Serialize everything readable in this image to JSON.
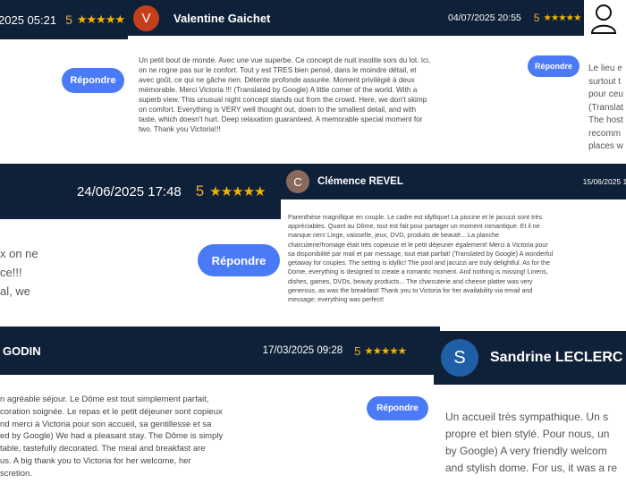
{
  "colors": {
    "header_bg": "#0f2138",
    "button_bg": "#4a7af5",
    "star": "#f5b301",
    "score": "#e8a93b"
  },
  "reply_label": "Répondre",
  "star_glyphs": "★★★★★",
  "reviews": [
    {
      "date_fragment": "2025 05:21",
      "score": "5"
    },
    {
      "name": "Valentine Gaichet",
      "initial": "V",
      "avatar_color": "#c43f1c",
      "text": "Un petit bout de monde. Avec une vue superbe. Ce concept de nuit insolite sors du lot. Ici, on ne rogne pas sur le confort. Tout y est TRES bien pensé, dans le moindre détail, et avec goût, ce qui ne gâche rien. Détente profonde assurée. Moment privilégié à deux mémorable. Merci Victoria !!! (Translated by Google) A little corner of the world. With a superb view. This unusual night concept stands out from the crowd. Here, we don't skimp on comfort. Everything is VERY well thought out, down to the smallest detail, and with taste, which doesn't hurt. Deep relaxation guaranteed. A memorable special moment for two. Thank you Victoria!!!"
    },
    {
      "date": "04/07/2025 20:55",
      "score": "5",
      "text_lines": [
        "Le lieu e",
        "surtout t",
        "pour ceu",
        "(Translat",
        "The host",
        "recomm",
        "places w"
      ]
    },
    {
      "date": "24/06/2025 17:48",
      "score": "5",
      "text_lines": [
        "x on ne",
        "ce!!!",
        "al, we"
      ]
    },
    {
      "name": "Clémence REVEL",
      "initial": "C",
      "avatar_color": "#8a6a5c",
      "date_fragment": "15/06/2025 19",
      "text": "Parenthèse magnifique en couple. Le cadre est idyllique! La piscine et le jacuzzi sont très appréciables. Quant au Dôme, tout est fait pour partager un moment romantique. Et il ne manque rien! Linge, vaisselle, jeux, DVD, produits de beauté... La planche charcuterie/fromage était très copieuse et le petit déjeuner également! Merci à Victoria pour sa disponibilité par mail et par message, tout était parfait! (Translated by Google) A wonderful getaway for couples. The setting is idyllic! The pool and jacuzzi are truly delightful. As for the Dome, everything is designed to create a romantic moment. And nothing is missing! Linens, dishes, games, DVDs, beauty products... The charcuterie and cheese platter was very generous, as was the breakfast! Thank you to Victoria for her availability via email and message; everything was perfect!"
    },
    {
      "name_fragment": "GODIN",
      "date": "17/03/2025 09:28",
      "score": "5",
      "text_lines": [
        "n agréable séjour. Le Dôme est tout simplement parfait,",
        "coration soignée. Le repas et le petit déjeuner sont copieux",
        "nd merci à Victoria pour son accueil, sa gentillesse et sa",
        "ed by Google) We had a pleasant stay. The Dôme is simply",
        "table, tastefully decorated. The meal and breakfast are",
        "us. A big thank you to Victoria for her welcome, her",
        "scretion."
      ]
    },
    {
      "name_fragment": "Sandrine LECLERC",
      "initial": "S",
      "avatar_color": "#1f5fa8",
      "text_lines": [
        "Un accueil très sympathique. Un s",
        "propre et bien stylé. Pour nous, un",
        "by Google) A very friendly welcom",
        "and stylish dome. For us, it was a re"
      ]
    }
  ]
}
